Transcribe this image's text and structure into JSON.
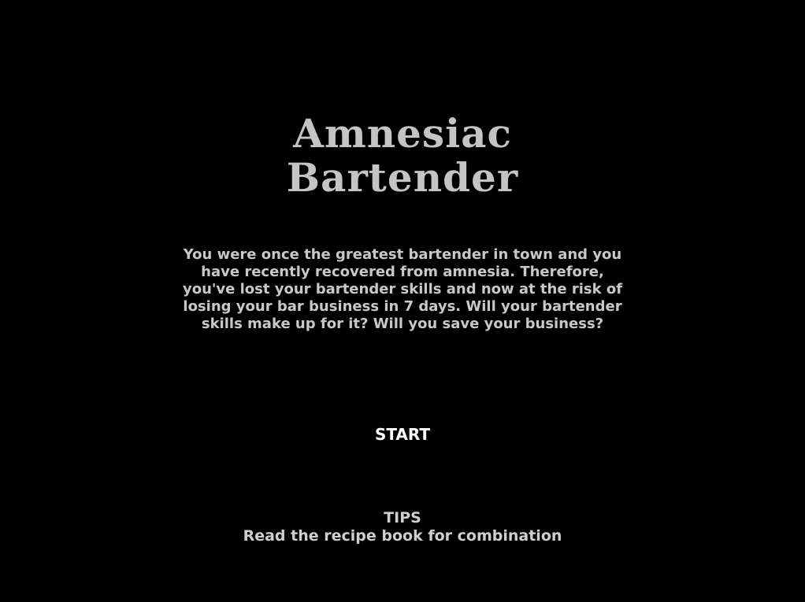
{
  "game": {
    "title_line_1": "Amnesiac",
    "title_line_2": "Bartender",
    "intro_text": "You were once the greatest bartender in town and you have recently recovered from amnesia. Therefore, you've lost your bartender skills and now at the risk of losing your bar business in 7 days. Will your bartender skills make up for it? Will you save your business?",
    "start_label": "START",
    "tips_heading": "TIPS",
    "tips_text": "Read the recipe book for combination"
  },
  "colors": {
    "background": "#000000",
    "title": "#c4c4c4",
    "body_text": "#c8c8c8",
    "start_text": "#ffffff"
  }
}
